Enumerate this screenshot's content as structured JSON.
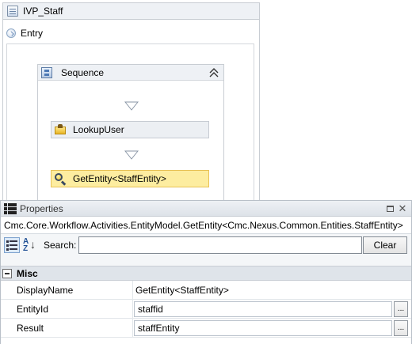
{
  "designer": {
    "workflow_title": "IVP_Staff",
    "entry_label": "Entry",
    "sequence": {
      "title": "Sequence",
      "activities": [
        {
          "label": "LookupUser",
          "selected": false
        },
        {
          "label": "GetEntity<StaffEntity>",
          "selected": true
        }
      ]
    }
  },
  "properties": {
    "title": "Properties",
    "type_name": "Cmc.Core.Workflow.Activities.EntityModel.GetEntity<Cmc.Nexus.Common.Entities.StaffEntity>",
    "search_label": "Search:",
    "search_value": "",
    "clear_label": "Clear",
    "category": "Misc",
    "rows": [
      {
        "name": "DisplayName",
        "value": "GetEntity<StaffEntity>"
      },
      {
        "name": "EntityId",
        "value": "staffid"
      },
      {
        "name": "Result",
        "value": "staffEntity"
      }
    ],
    "ellipsis": "..."
  },
  "icons": {
    "workflow": "workflow-doc-icon",
    "entry": "entry-icon",
    "sequence": "sequence-icon",
    "collapse": "double-chevron-up-icon",
    "lookup": "lookup-user-icon",
    "getentity": "magnifier-icon",
    "panel": "property-grid-icon",
    "restore": "restore-window-icon",
    "close": "close-icon"
  },
  "colors": {
    "selected_activity_bg": "#fdeda0",
    "selected_activity_border": "#e8c255",
    "header_bg": "#eef1f5"
  }
}
